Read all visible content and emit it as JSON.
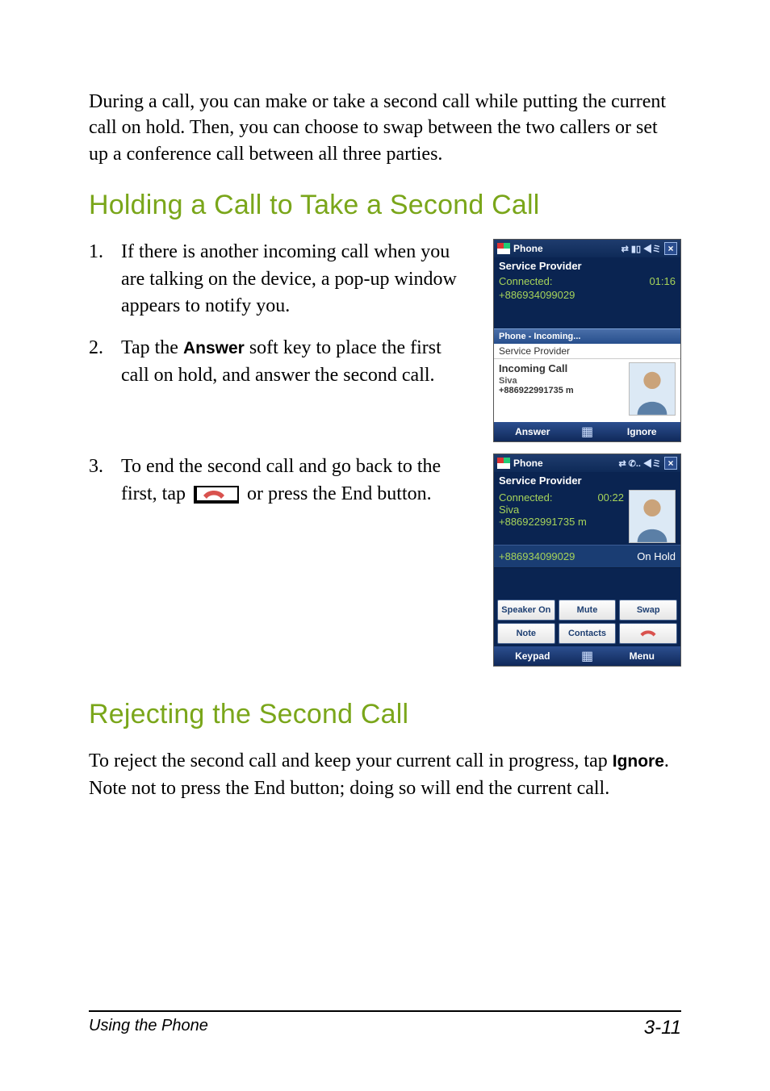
{
  "intro": "During a call, you can make or take a second call while putting the current call on hold. Then, you can choose to swap between the two callers or set up a conference call between all three parties.",
  "heading1": "Holding a Call to Take a Second Call",
  "steps_a": [
    {
      "num": "1.",
      "text": "If there is another incoming call when you are talking on the device, a pop-up window appears to notify you."
    },
    {
      "num": "2.",
      "pre": "Tap the ",
      "bold": "Answer",
      "post": " soft key to place the first call on hold, and answer the second call."
    }
  ],
  "steps_b": [
    {
      "num": "3.",
      "pre": "To end the second call and go back to the first, tap ",
      "post": " or press the End button."
    }
  ],
  "heading2": "Rejecting the Second Call",
  "reject": {
    "pre": "To reject the second call and keep your current call in progress, tap ",
    "bold": "Ignore",
    "post": ". Note not to press the End button; doing so will end the current call."
  },
  "footer": {
    "left": "Using the Phone",
    "right": "3-11"
  },
  "shot1": {
    "title": "Phone",
    "provider": "Service Provider",
    "connected_label": "Connected:",
    "connected_num": "+886934099029",
    "elapsed": "01:16",
    "popup_title": "Phone - Incoming...",
    "popup_provider": "Service Provider",
    "incoming_label": "Incoming Call",
    "caller_name": "Siva",
    "caller_num": "+886922991735 m",
    "soft_left": "Answer",
    "soft_right": "Ignore"
  },
  "shot2": {
    "title": "Phone",
    "provider": "Service Provider",
    "connected_label": "Connected:",
    "elapsed": "00:22",
    "caller_name": "Siva",
    "caller_num": "+886922991735 m",
    "hold_num": "+886934099029",
    "hold_label": "On Hold",
    "btn_speaker": "Speaker On",
    "btn_mute": "Mute",
    "btn_swap": "Swap",
    "btn_note": "Note",
    "btn_contacts": "Contacts",
    "soft_left": "Keypad",
    "soft_right": "Menu"
  }
}
